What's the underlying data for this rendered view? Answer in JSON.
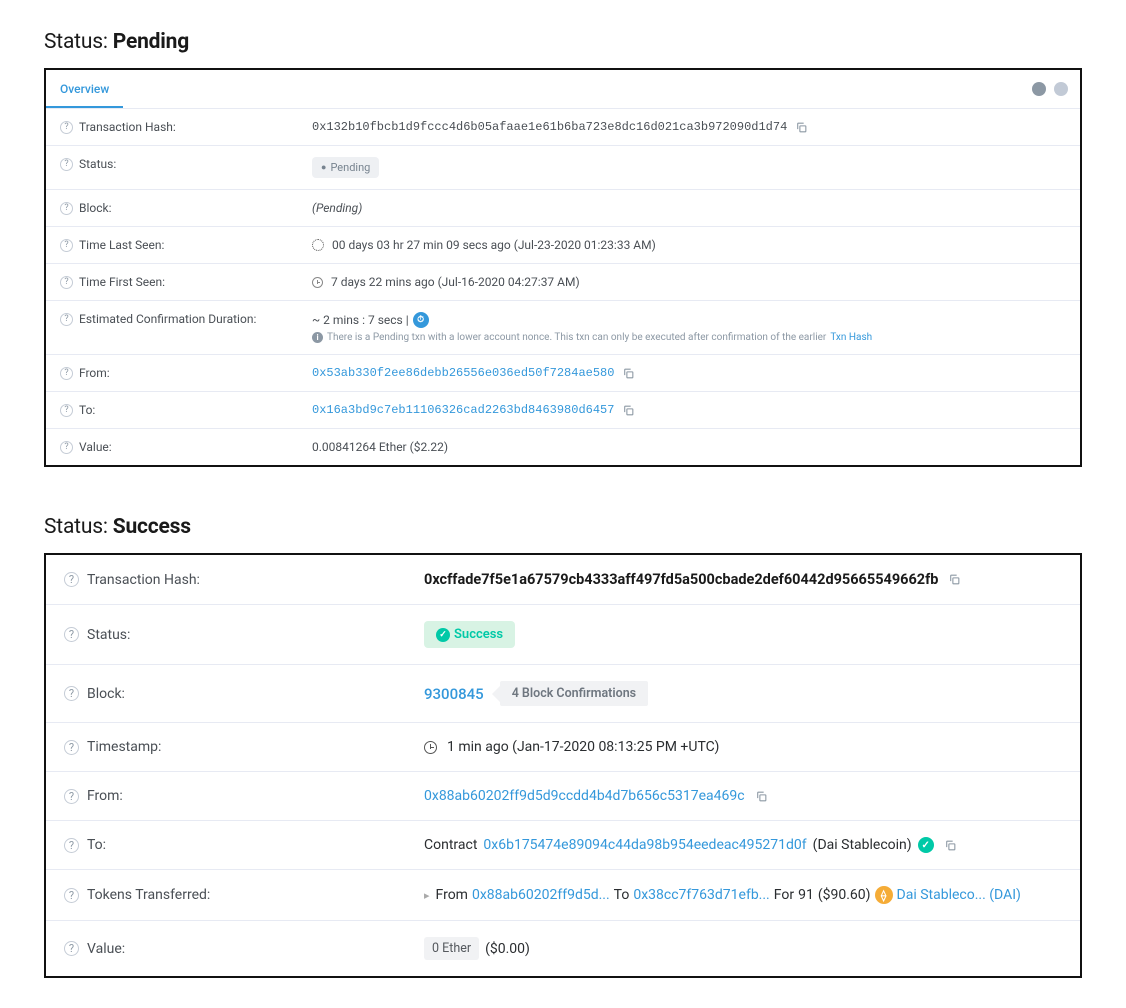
{
  "headings": {
    "pending_label": "Status: ",
    "pending_status": "Pending",
    "success_label": "Status: ",
    "success_status": "Success"
  },
  "pending": {
    "tab": "Overview",
    "labels": {
      "txhash": "Transaction Hash:",
      "status": "Status:",
      "block": "Block:",
      "time_last": "Time Last Seen:",
      "time_first": "Time First Seen:",
      "est_conf": "Estimated Confirmation Duration:",
      "from": "From:",
      "to": "To:",
      "value": "Value:"
    },
    "txhash": "0x132b10fbcb1d9fccc4d6b05afaae1e61b6ba723e8dc16d021ca3b972090d1d74",
    "status_badge": "Pending",
    "block": "(Pending)",
    "time_last": "00 days 03 hr 27 min 09 secs ago (Jul-23-2020 01:23:33 AM)",
    "time_first": "7 days 22 mins ago (Jul-16-2020 04:27:37 AM)",
    "est_conf": "~ 2 mins : 7 secs |",
    "est_note": "There is a Pending txn with a lower account nonce. This txn can only be executed after confirmation of the earlier",
    "est_note_link": "Txn Hash",
    "from": "0x53ab330f2ee86debb26556e036ed50f7284ae580",
    "to": "0x16a3bd9c7eb11106326cad2263bd8463980d6457",
    "value": "0.00841264 Ether ($2.22)"
  },
  "success": {
    "labels": {
      "txhash": "Transaction Hash:",
      "status": "Status:",
      "block": "Block:",
      "timestamp": "Timestamp:",
      "from": "From:",
      "to": "To:",
      "tokens": "Tokens Transferred:",
      "value": "Value:"
    },
    "txhash": "0xcffade7f5e1a67579cb4333aff497fd5a500cbade2def60442d95665549662fb",
    "status_badge": "Success",
    "block": "9300845",
    "block_conf": "4 Block Confirmations",
    "timestamp": "1 min ago (Jan-17-2020 08:13:25 PM +UTC)",
    "from": "0x88ab60202ff9d5d9ccdd4b4d7b656c5317ea469c",
    "to_prefix": "Contract",
    "to": "0x6b175474e89094c44da98b954eedeac495271d0f",
    "to_suffix": "(Dai Stablecoin)",
    "tokens_from_label": "From",
    "tokens_from": "0x88ab60202ff9d5d...",
    "tokens_to_label": "To",
    "tokens_to": "0x38cc7f763d71efb...",
    "tokens_for_label": "For",
    "tokens_amount": "91",
    "tokens_usd": "($90.60)",
    "tokens_name": "Dai Stableco... (DAI)",
    "value_badge": "0 Ether",
    "value_usd": "($0.00)"
  }
}
